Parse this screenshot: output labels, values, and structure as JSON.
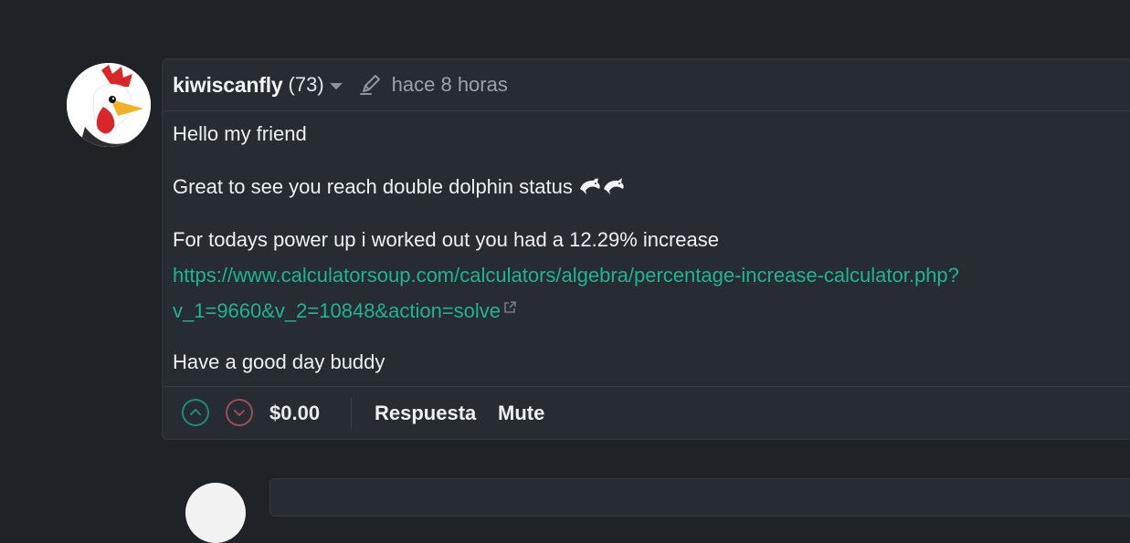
{
  "comment": {
    "author": "kiwiscanfly",
    "reputation": "(73)",
    "time": "hace 8 horas",
    "paragraphs": {
      "greeting": "Hello my friend",
      "status": "Great to see you reach double dolphin status",
      "increase": "For todays power up i worked out you had a 12.29% increase",
      "link_line1": "https://www.calculatorsoup.com/calculators/algebra/percentage-increase-calculator.php?",
      "link_line2": "v_1=9660&v_2=10848&action=solve",
      "closing": "Have a good day buddy"
    },
    "emojis": [
      "dolphin",
      "dolphin"
    ],
    "footer": {
      "payout": "$0.00",
      "reply_label": "Respuesta",
      "mute_label": "Mute"
    }
  },
  "icons": {
    "avatar": "rooster-avatar",
    "caret": "caret-down-icon",
    "edit": "pencil-edit-icon",
    "external": "external-link-icon",
    "upvote": "chevron-up-icon",
    "downvote": "chevron-down-icon"
  },
  "colors": {
    "background": "#1f2327",
    "card": "#262c31",
    "link": "#20b393",
    "upvote": "#1f8a73",
    "downvote": "#9b4d57"
  }
}
